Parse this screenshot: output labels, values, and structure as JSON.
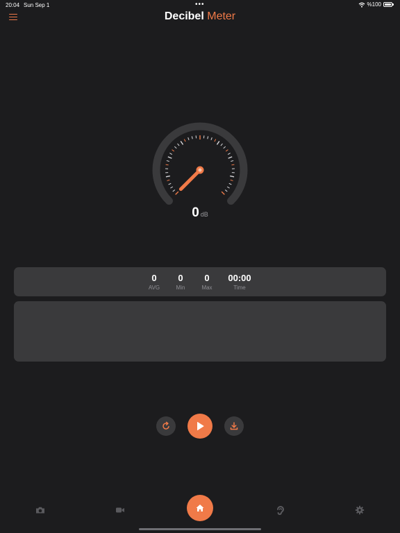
{
  "status_bar": {
    "time": "20:04",
    "date": "Sun Sep 1",
    "battery": "%100"
  },
  "header": {
    "title_main": "Decibel",
    "title_accent": "Meter"
  },
  "gauge": {
    "value": "0",
    "unit": "dB",
    "level_fraction": 0
  },
  "stats": [
    {
      "value": "0",
      "label": "AVG"
    },
    {
      "value": "0",
      "label": "Min"
    },
    {
      "value": "0",
      "label": "Max"
    },
    {
      "value": "00:00",
      "label": "Time"
    }
  ],
  "controls": {
    "reset": "refresh-icon",
    "play": "play-icon",
    "save": "download-icon"
  },
  "tab_bar": {
    "items": [
      "camera-icon",
      "video-icon",
      "home-icon",
      "ear-icon",
      "gear-icon"
    ]
  },
  "colors": {
    "accent": "#f07a48",
    "background": "#1c1c1e",
    "card": "#3a3a3c"
  }
}
